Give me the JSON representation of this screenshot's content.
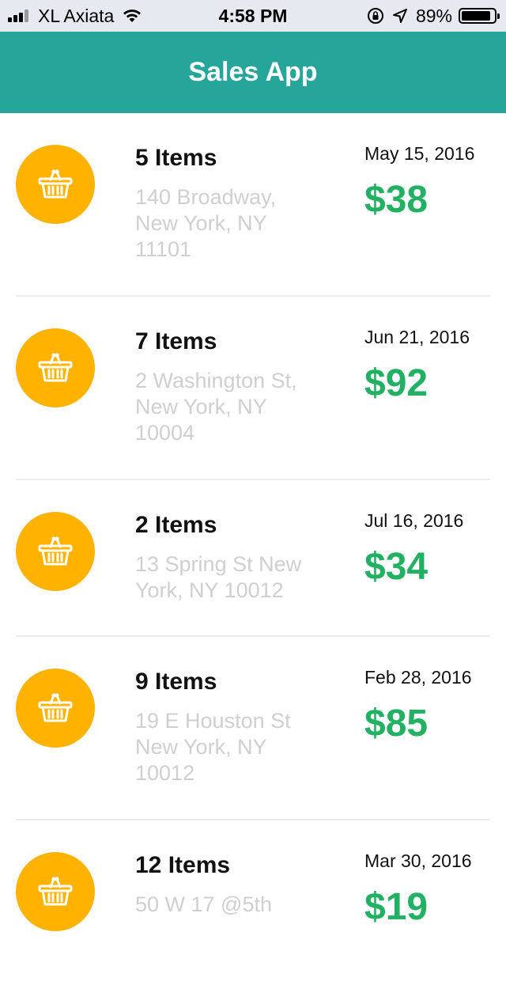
{
  "status_bar": {
    "carrier": "XL Axiata",
    "time": "4:58 PM",
    "battery_percent_label": "89%",
    "battery_level": 0.89,
    "icons": [
      "signal-icon",
      "wifi-icon",
      "rotation-lock-icon",
      "location-arrow-icon",
      "battery-icon"
    ]
  },
  "header": {
    "title": "Sales App",
    "background_color": "#26a69a"
  },
  "colors": {
    "accent": "#26a69a",
    "avatar": "#ffb300",
    "amount": "#22b162",
    "address": "#cfcfcf"
  },
  "sales": [
    {
      "items_label": "5 Items",
      "address": "140 Broadway, New York, NY 11101",
      "date": "May 15, 2016",
      "amount": "$38",
      "icon": "basket-icon"
    },
    {
      "items_label": "7 Items",
      "address": "2 Washington St, New York, NY 10004",
      "date": "Jun 21, 2016",
      "amount": "$92",
      "icon": "basket-icon"
    },
    {
      "items_label": "2 Items",
      "address": "13 Spring St New York, NY 10012",
      "date": "Jul 16, 2016",
      "amount": "$34",
      "icon": "basket-icon"
    },
    {
      "items_label": "9 Items",
      "address": "19 E Houston St New York, NY 10012",
      "date": "Feb 28, 2016",
      "amount": "$85",
      "icon": "basket-icon"
    },
    {
      "items_label": "12 Items",
      "address": "50 W 17 @5th",
      "date": "Mar 30, 2016",
      "amount": "$19",
      "icon": "basket-icon"
    }
  ]
}
